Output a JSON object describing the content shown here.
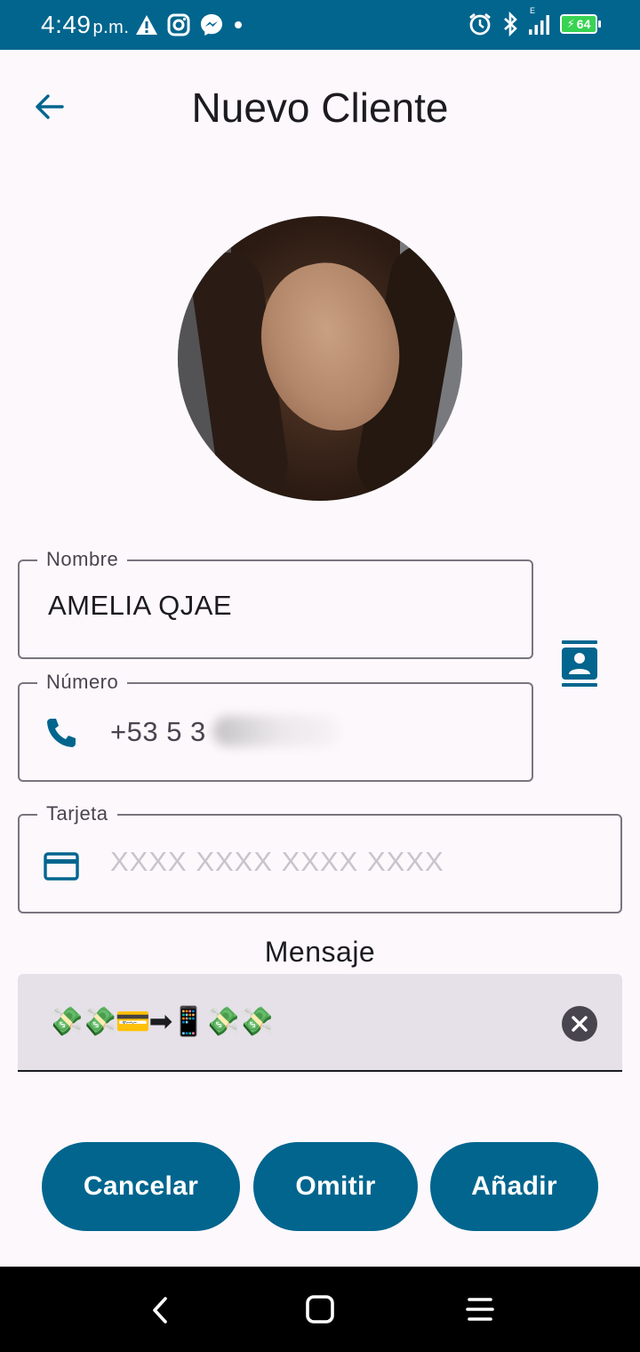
{
  "status_bar": {
    "time": "4:49",
    "ampm": "p.m.",
    "battery": "64",
    "left_icons": [
      "warning-icon",
      "instagram-icon",
      "messenger-icon",
      "dot-icon"
    ],
    "right_icons": [
      "alarm-icon",
      "bluetooth-icon",
      "signal-icon",
      "battery-icon"
    ],
    "network_label": "E"
  },
  "header": {
    "title": "Nuevo Cliente",
    "back_icon": "arrow-left-icon"
  },
  "form": {
    "name": {
      "label": "Nombre",
      "value": "AMELIA QJAE"
    },
    "number": {
      "label": "Número",
      "value": "+53 5 3",
      "icon": "phone-icon"
    },
    "card": {
      "label": "Tarjeta",
      "placeholder": "XXXX XXXX XXXX XXXX",
      "icon": "credit-card-icon"
    },
    "contacts_icon": "contacts-icon"
  },
  "message": {
    "label": "Mensaje",
    "value": "💸💸💳➡📱💸💸",
    "clear_icon": "clear-icon"
  },
  "buttons": {
    "cancel": "Cancelar",
    "skip": "Omitir",
    "add": "Añadir"
  },
  "nav": {
    "icons": [
      "back-icon",
      "home-icon",
      "recents-icon"
    ]
  },
  "colors": {
    "primary": "#01658e",
    "background": "#fcf8fc",
    "message_bg": "#e6e0e9"
  }
}
